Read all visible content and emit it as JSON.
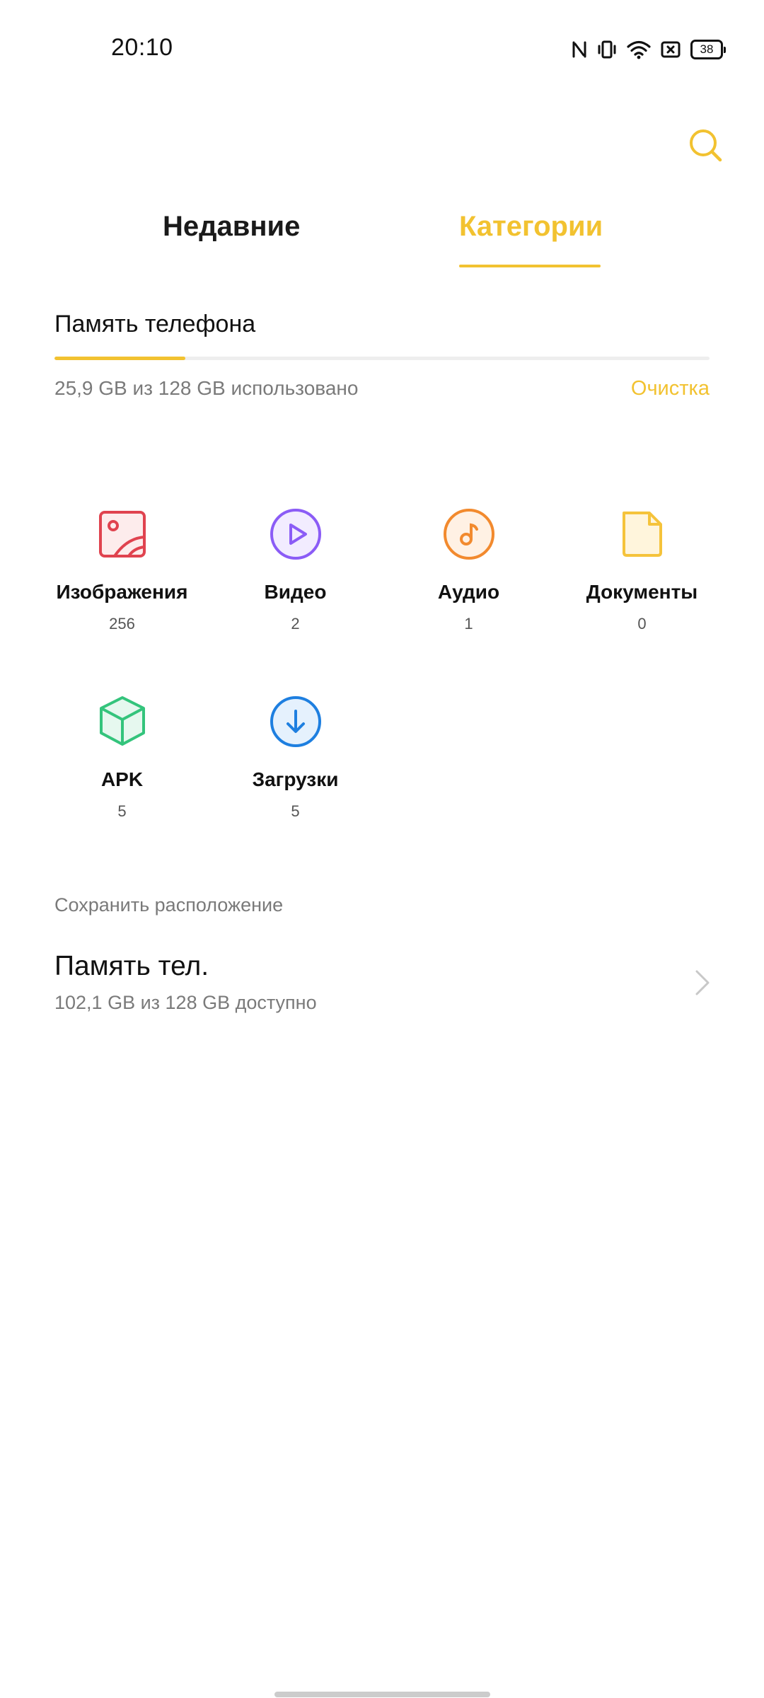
{
  "status_bar": {
    "time": "20:10",
    "battery": "38",
    "icons": [
      "nfc-icon",
      "vibrate-icon",
      "wifi-icon",
      "no-sim-icon",
      "battery-icon"
    ]
  },
  "header": {
    "search_icon": "search-icon"
  },
  "tabs": [
    {
      "label": "Недавние",
      "active": false
    },
    {
      "label": "Категории",
      "active": true
    }
  ],
  "storage": {
    "title": "Память телефона",
    "usage_text": "25,9 GB из 128 GB использовано",
    "used_fraction": 0.2,
    "clean_label": "Очистка"
  },
  "categories": [
    {
      "label": "Изображения",
      "count": "256",
      "icon": "image-icon",
      "color": "#e0434f"
    },
    {
      "label": "Видео",
      "count": "2",
      "icon": "play-icon",
      "color": "#8b5cf6"
    },
    {
      "label": "Аудио",
      "count": "1",
      "icon": "music-note-icon",
      "color": "#f28a2e"
    },
    {
      "label": "Документы",
      "count": "0",
      "icon": "document-icon",
      "color": "#f5c33b"
    },
    {
      "label": "APK",
      "count": "5",
      "icon": "package-icon",
      "color": "#34c47c"
    },
    {
      "label": "Загрузки",
      "count": "5",
      "icon": "download-icon",
      "color": "#1e7fe0"
    }
  ],
  "save_location": {
    "title": "Сохранить расположение",
    "name": "Память тел.",
    "subtitle": "102,1 GB из 128 GB доступно"
  },
  "colors": {
    "accent": "#f2c230",
    "text_secondary": "#7a7a7a"
  }
}
